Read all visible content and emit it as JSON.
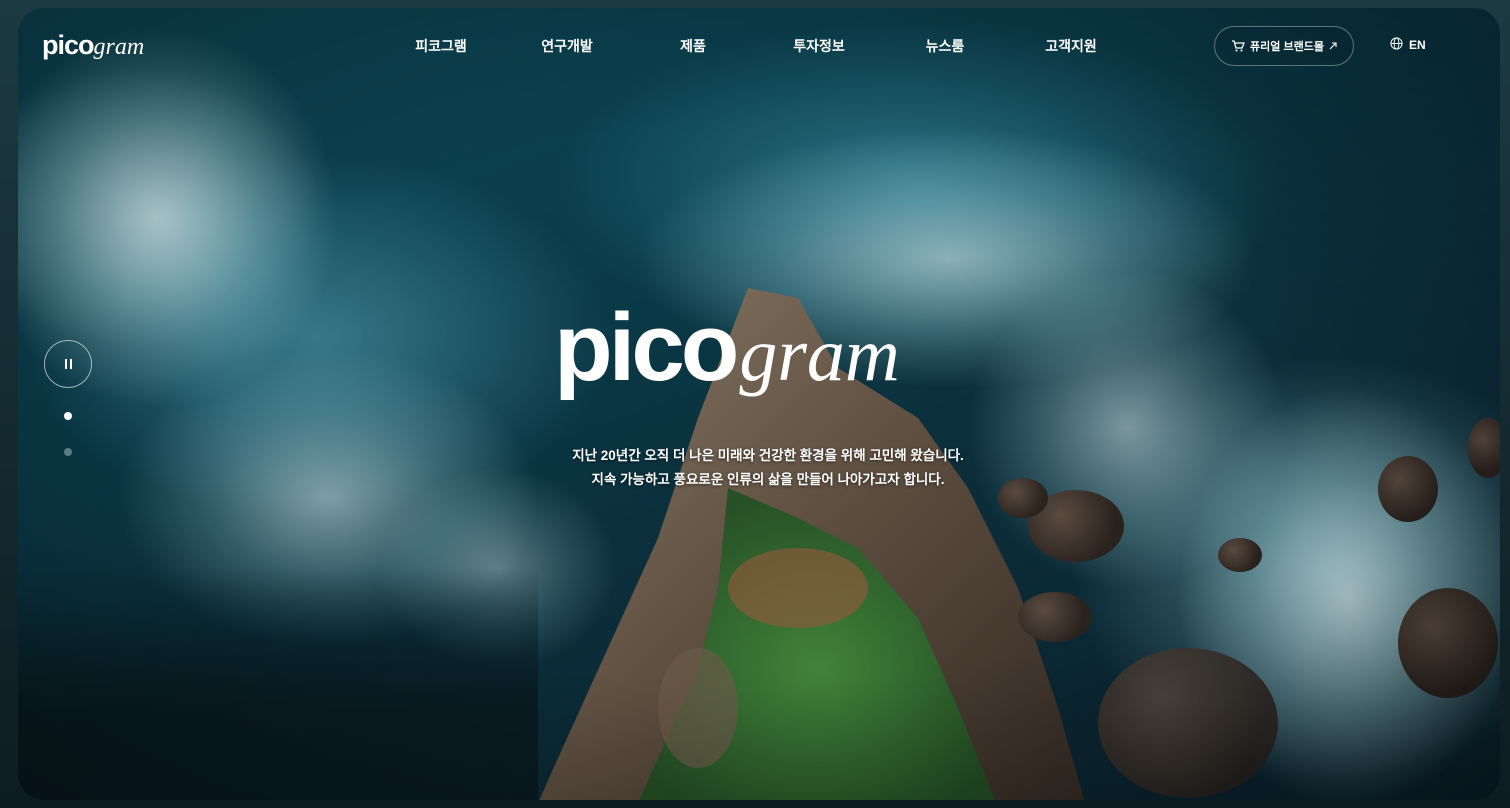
{
  "header": {
    "logo": {
      "bold": "pico",
      "italic": "gram"
    },
    "nav": [
      {
        "label": "피코그램"
      },
      {
        "label": "연구개발"
      },
      {
        "label": "제품"
      },
      {
        "label": "투자정보"
      },
      {
        "label": "뉴스룸"
      },
      {
        "label": "고객지원"
      }
    ],
    "shop_button": {
      "label": "퓨리얼 브랜드몰",
      "icon": "cart-icon",
      "arrow_icon": "external-arrow-icon"
    },
    "language": {
      "label": "EN",
      "icon": "globe-icon"
    }
  },
  "hero": {
    "title_bold": "pico",
    "title_italic": "gram",
    "line1": "지난 20년간 오직 더 나은 미래와 건강한 환경을 위해 고민해 왔습니다.",
    "line2": "지속 가능하고 풍요로운 인류의 삶을 만들어 나아가고자 합니다."
  },
  "slider": {
    "pause_icon": "pause-icon",
    "dots": 2,
    "active_index": 0
  },
  "colors": {
    "text": "#ffffff",
    "ocean_deep": "#0a3b49",
    "ocean_light": "#5aaabe"
  }
}
